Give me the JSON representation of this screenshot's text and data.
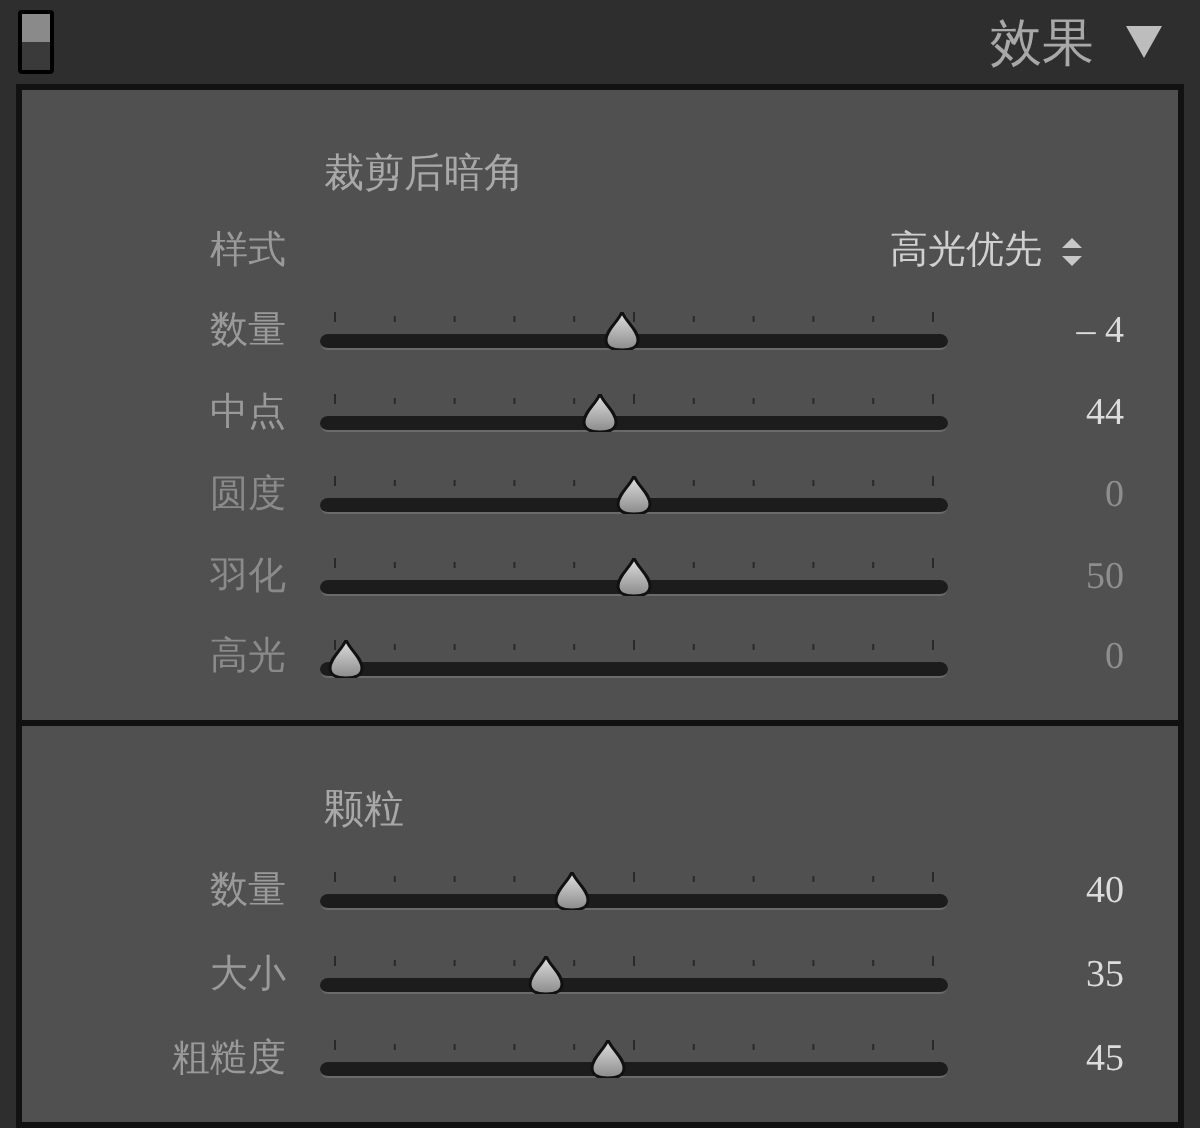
{
  "header": {
    "title": "效果",
    "expanded": true
  },
  "sections": [
    {
      "title": "裁剪后暗角",
      "style": {
        "label": "样式",
        "value": "高光优先"
      },
      "sliders": [
        {
          "label": "数量",
          "value": "– 4",
          "level": 0.48,
          "disabled": false
        },
        {
          "label": "中点",
          "value": "44",
          "level": 0.445,
          "disabled": false
        },
        {
          "label": "圆度",
          "value": "0",
          "level": 0.5,
          "disabled": true
        },
        {
          "label": "羽化",
          "value": "50",
          "level": 0.5,
          "disabled": true
        },
        {
          "label": "高光",
          "value": "0",
          "level": 0.04,
          "disabled": true
        }
      ]
    },
    {
      "title": "颗粒",
      "sliders": [
        {
          "label": "数量",
          "value": "40",
          "level": 0.4,
          "disabled": false
        },
        {
          "label": "大小",
          "value": "35",
          "level": 0.36,
          "disabled": false
        },
        {
          "label": "粗糙度",
          "value": "45",
          "level": 0.46,
          "disabled": false
        }
      ]
    }
  ]
}
